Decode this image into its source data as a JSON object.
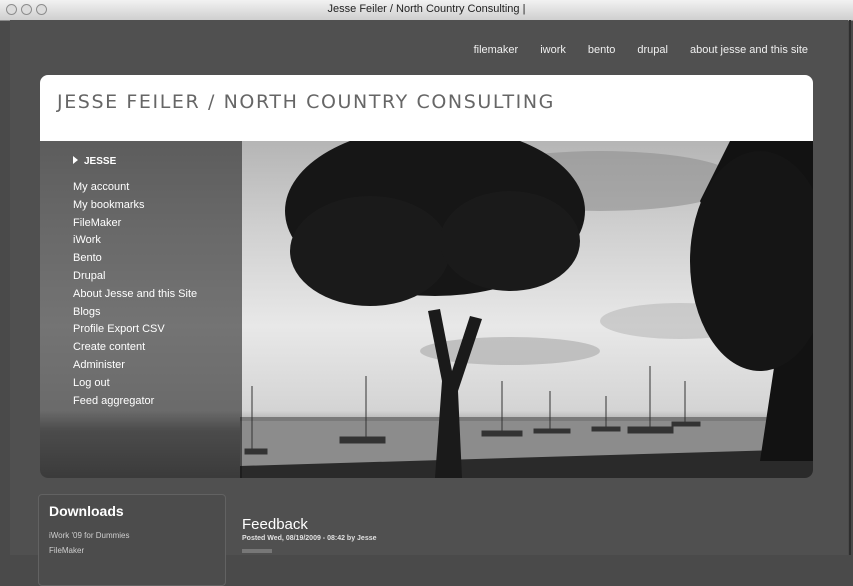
{
  "window": {
    "title": "Jesse Feiler / North Country Consulting |"
  },
  "topnav": {
    "items": [
      "filemaker",
      "iwork",
      "bento",
      "drupal",
      "about jesse and this site"
    ]
  },
  "header": {
    "site_title": "JESSE FEILER / NORTH COUNTRY CONSULTING"
  },
  "user_menu": {
    "heading": "JESSE",
    "items": [
      "My account",
      "My bookmarks",
      "FileMaker",
      "iWork",
      "Bento",
      "Drupal",
      "About Jesse and this Site",
      "Blogs",
      "Profile Export CSV",
      "Create content",
      "Administer",
      "Log out",
      "Feed aggregator"
    ]
  },
  "downloads": {
    "heading": "Downloads",
    "items": [
      "iWork '09 for Dummies",
      "FileMaker"
    ]
  },
  "post": {
    "title": "Feedback",
    "meta": "Posted Wed, 08/19/2009 - 08:42 by Jesse"
  }
}
